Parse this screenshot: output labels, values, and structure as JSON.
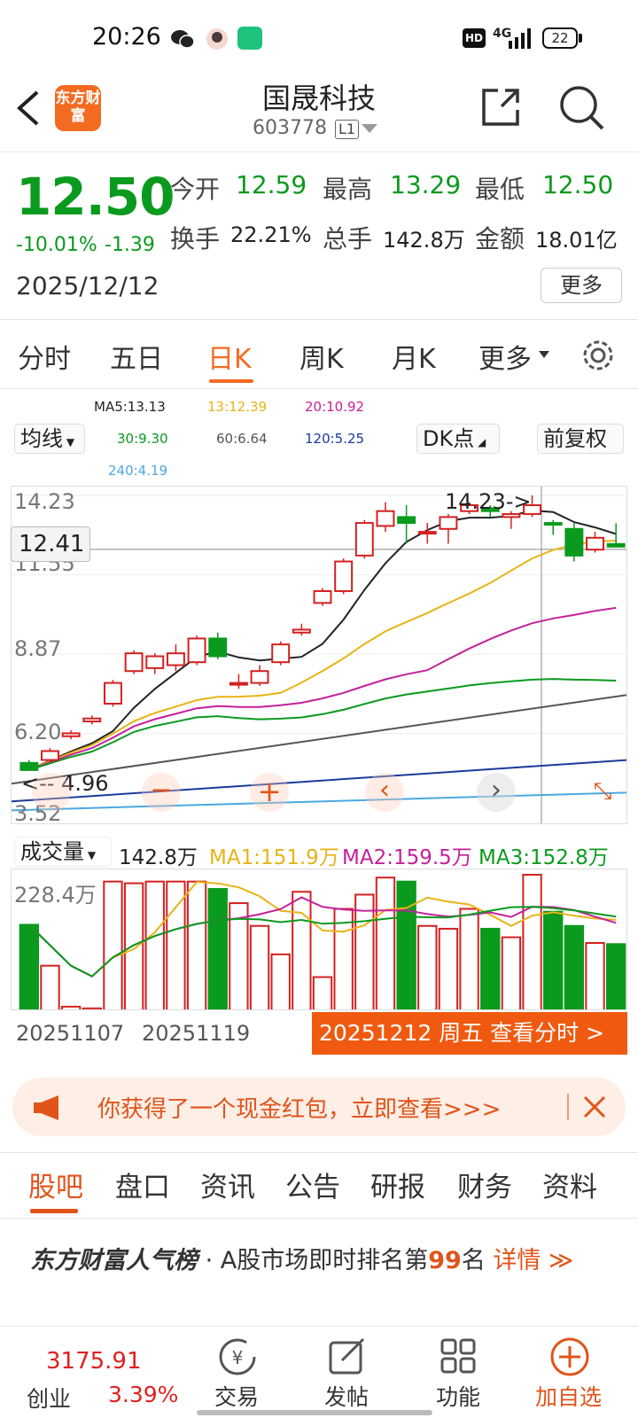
{
  "status_bar": {
    "time": "20:26",
    "battery": "22",
    "network": "4G"
  },
  "header": {
    "title": "国晟科技",
    "code": "603778",
    "level": "L1",
    "logo_text": "东方财富"
  },
  "quote": {
    "price": "12.50",
    "change_pct": "-10.01%",
    "change": "-1.39",
    "date": "2025/12/12",
    "open_label": "今开",
    "open": "12.59",
    "high_label": "最高",
    "high": "13.29",
    "low_label": "最低",
    "low": "12.50",
    "turnover_label": "换手",
    "turnover": "22.21%",
    "volume_label": "总手",
    "volume": "142.8万",
    "amount_label": "金额",
    "amount": "18.01亿",
    "more_label": "更多"
  },
  "kline_tabs": [
    "分时",
    "五日",
    "日K",
    "周K",
    "月K",
    "更多"
  ],
  "ma_legend": {
    "ma5": "MA5:13.13",
    "ma13": "13:12.39",
    "ma20": "20:10.92",
    "ma30": "30:9.30",
    "ma60": "60:6.64",
    "ma120": "120:5.25",
    "ma240": "240:4.19"
  },
  "controls": {
    "line_select": "均线",
    "dk_select": "DK点",
    "adjust": "前复权"
  },
  "chart_labels": {
    "y_top": "14.23",
    "y_current": "12.41",
    "y_mid1": "11.55",
    "y_mid2": "8.87",
    "y_low1": "6.20",
    "y_bottom": "3.52",
    "high_marker": "14.23->",
    "low_marker": "<-- 4.96"
  },
  "volume": {
    "select": "成交量",
    "value": "142.8万",
    "ma1": "MA1:151.9万",
    "ma2": "MA2:159.5万",
    "ma3": "MA3:152.8万",
    "y_top": "228.4万"
  },
  "x_axis": {
    "d1": "20251107",
    "d2": "20251119"
  },
  "time_banner": "20251212 周五 查看分时 >",
  "packet_banner": "你获得了一个现金红包，立即查看>>>",
  "bottom_tabs": [
    "股吧",
    "盘口",
    "资讯",
    "公告",
    "研报",
    "财务",
    "资料"
  ],
  "rank": {
    "brand": "东方财富人气榜",
    "text": "· A股市场即时排名第",
    "num": "99",
    "unit": "名",
    "link": "详情"
  },
  "nav": {
    "index_value": "3175.91",
    "index_name": "创业",
    "index_pct": "3.39%",
    "trade": "交易",
    "post": "发帖",
    "func": "功能",
    "add": "加自选"
  },
  "colors": {
    "up": "#e02020",
    "down": "#0a9a1e",
    "accent": "#f36b21"
  },
  "chart_data": {
    "type": "candlestick",
    "note_series": [
      "MA5",
      "MA13",
      "MA20",
      "MA30",
      "MA60",
      "MA120",
      "MA240"
    ],
    "ylim": [
      3.52,
      14.23
    ],
    "candles": [
      {
        "o": 5.2,
        "c": 4.96,
        "h": 5.3,
        "l": 4.96
      },
      {
        "o": 5.3,
        "c": 5.6,
        "h": 5.7,
        "l": 5.2
      },
      {
        "o": 6.1,
        "c": 6.2,
        "h": 6.3,
        "l": 6.0
      },
      {
        "o": 6.6,
        "c": 6.7,
        "h": 6.8,
        "l": 6.5
      },
      {
        "o": 7.2,
        "c": 7.9,
        "h": 8.0,
        "l": 7.1
      },
      {
        "o": 8.3,
        "c": 8.9,
        "h": 9.0,
        "l": 8.2
      },
      {
        "o": 8.4,
        "c": 8.8,
        "h": 8.9,
        "l": 8.2
      },
      {
        "o": 8.5,
        "c": 8.9,
        "h": 9.2,
        "l": 8.3
      },
      {
        "o": 8.6,
        "c": 9.4,
        "h": 9.5,
        "l": 8.5
      },
      {
        "o": 9.4,
        "c": 8.8,
        "h": 9.6,
        "l": 8.7
      },
      {
        "o": 7.9,
        "c": 7.9,
        "h": 8.2,
        "l": 7.7
      },
      {
        "o": 7.9,
        "c": 8.3,
        "h": 8.5,
        "l": 7.8
      },
      {
        "o": 8.6,
        "c": 9.2,
        "h": 9.3,
        "l": 8.5
      },
      {
        "o": 9.6,
        "c": 9.7,
        "h": 9.9,
        "l": 9.5
      },
      {
        "o": 10.6,
        "c": 11.0,
        "h": 11.1,
        "l": 10.5
      },
      {
        "o": 11.0,
        "c": 12.0,
        "h": 12.1,
        "l": 10.9
      },
      {
        "o": 12.2,
        "c": 13.3,
        "h": 13.4,
        "l": 12.1
      },
      {
        "o": 13.2,
        "c": 13.7,
        "h": 14.0,
        "l": 13.0
      },
      {
        "o": 13.5,
        "c": 13.3,
        "h": 13.9,
        "l": 12.6
      },
      {
        "o": 13.0,
        "c": 13.0,
        "h": 13.3,
        "l": 12.6
      },
      {
        "o": 13.1,
        "c": 13.5,
        "h": 13.6,
        "l": 12.6
      },
      {
        "o": 13.7,
        "c": 13.9,
        "h": 14.0,
        "l": 13.6
      },
      {
        "o": 13.8,
        "c": 13.7,
        "h": 13.9,
        "l": 13.5
      },
      {
        "o": 13.5,
        "c": 13.6,
        "h": 13.7,
        "l": 13.1
      },
      {
        "o": 13.6,
        "c": 13.9,
        "h": 14.23,
        "l": 13.5
      },
      {
        "o": 13.3,
        "c": 13.25,
        "h": 13.4,
        "l": 12.9
      },
      {
        "o": 13.1,
        "c": 12.2,
        "h": 13.3,
        "l": 12.0
      },
      {
        "o": 12.4,
        "c": 12.8,
        "h": 13.0,
        "l": 12.3
      },
      {
        "o": 12.59,
        "c": 12.5,
        "h": 13.29,
        "l": 12.5
      }
    ],
    "volumes": [
      152,
      80,
      8,
      5,
      228,
      225,
      228,
      228,
      228,
      215,
      190,
      150,
      100,
      210,
      60,
      180,
      205,
      235,
      228,
      150,
      145,
      180,
      145,
      130,
      240,
      175,
      150,
      120,
      118
    ]
  }
}
